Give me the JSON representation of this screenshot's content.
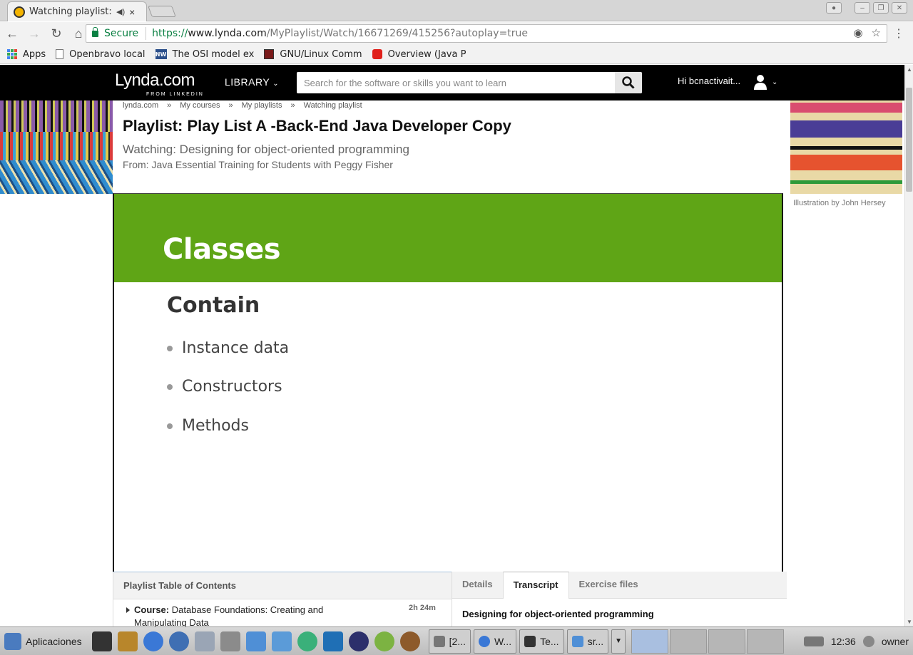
{
  "browser": {
    "tab_title": "Watching playlist: Play List A -Back-End Java Developer Copy",
    "tab_close": "×",
    "secure_label": "Secure",
    "url_scheme": "https://",
    "url_host": "www.lynda.com",
    "url_path": "/MyPlaylist/Watch/16671269/415256?autoplay=true"
  },
  "bookmarks": [
    {
      "label": "Apps",
      "icon": "apps-grid-icon"
    },
    {
      "label": "Openbravo local",
      "icon": "file-icon"
    },
    {
      "label": "The OSI model ex",
      "icon": "nw-icon"
    },
    {
      "label": "GNU/Linux Comm",
      "icon": "gnu-icon"
    },
    {
      "label": "Overview (Java P",
      "icon": "oracle-icon"
    }
  ],
  "lynda": {
    "logo": "Lynda.com",
    "logo_sub": "FROM LINKEDIN",
    "library": "LIBRARY",
    "search_placeholder": "Search for the software or skills you want to learn",
    "greeting": "Hi bcnactivait...",
    "breadcrumb": [
      "lynda.com",
      "My courses",
      "My playlists",
      "Watching playlist"
    ],
    "breadcrumb_sep": "»",
    "title": "Playlist: Play List A -Back-End Java Developer Copy",
    "watching": "Watching: Designing for object-oriented programming",
    "from": "From: Java Essential Training for Students with Peggy Fisher",
    "illustration_credit": "Illustration by John Hersey"
  },
  "slide": {
    "title": "Classes",
    "subtitle": "Contain",
    "bullets": [
      "Instance data",
      "Constructors",
      "Methods"
    ],
    "accent_color": "#5fa516"
  },
  "toc": {
    "header": "Playlist Table of Contents",
    "item_type": "Course:",
    "item_title": "Database Foundations: Creating and Manipulating Data",
    "item_duration": "2h 24m"
  },
  "detail_tabs": {
    "tabs": [
      "Details",
      "Transcript",
      "Exercise files"
    ],
    "active": "Transcript",
    "transcript_title": "Designing for object-oriented programming"
  },
  "taskbar": {
    "start_label": "Aplicaciones",
    "tasks": [
      "[2...",
      "W...",
      "Te...",
      "sr..."
    ],
    "time": "12:36",
    "user": "owner"
  }
}
